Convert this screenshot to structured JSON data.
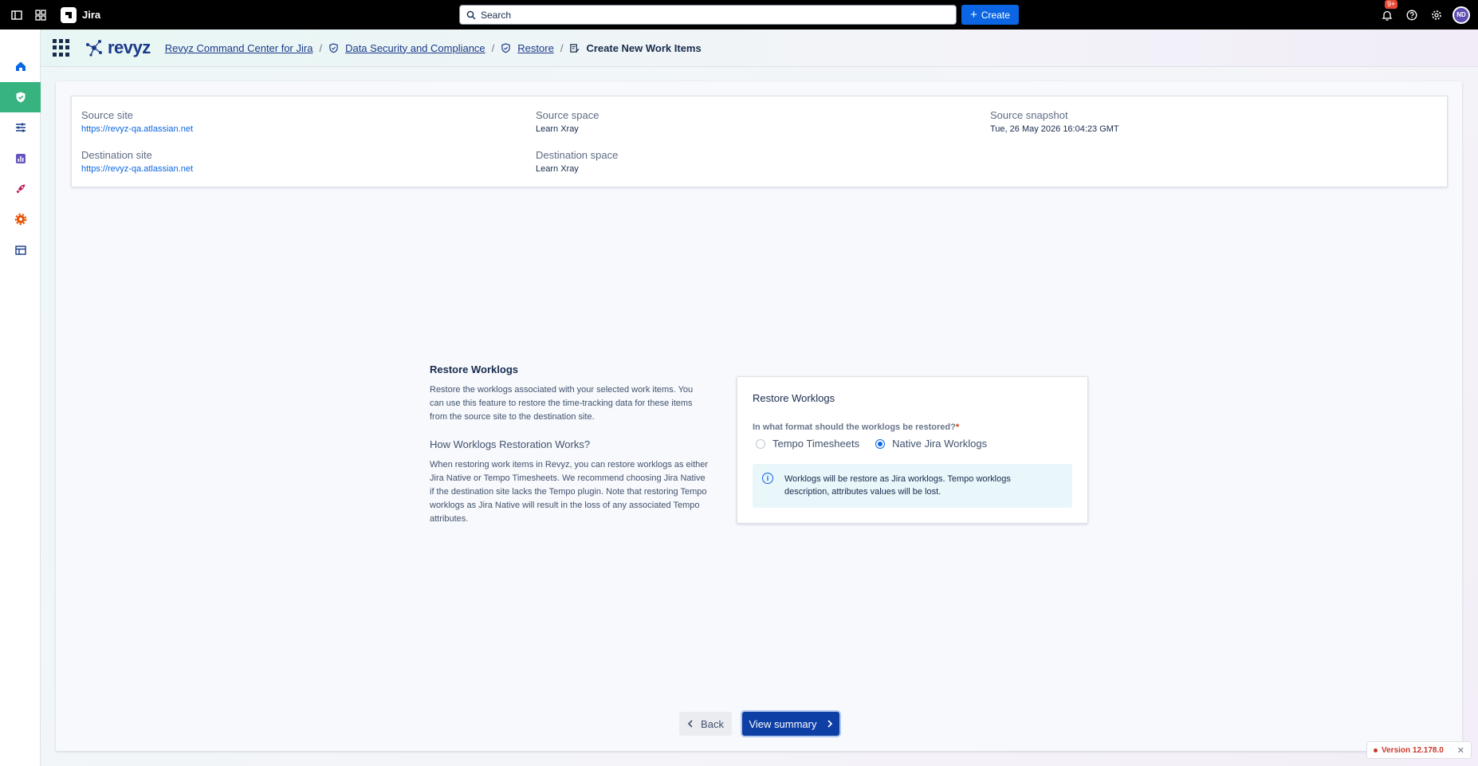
{
  "topbar": {
    "app_name": "Jira",
    "search_placeholder": "Search",
    "create_label": "Create",
    "notification_count": "9+",
    "avatar_initials": "ND"
  },
  "appbar": {
    "logo_text": "revyz",
    "breadcrumb": {
      "item1": "Revyz Command Center for Jira",
      "item2": "Data Security and Compliance",
      "item3": "Restore",
      "current": "Create New Work Items"
    }
  },
  "source_info": {
    "source_site_label": "Source site",
    "source_site_value": "https://revyz-qa.atlassian.net",
    "source_space_label": "Source space",
    "source_space_value": "Learn Xray",
    "source_snapshot_label": "Source snapshot",
    "source_snapshot_value": "Tue, 26 May 2026 16:04:23 GMT",
    "dest_site_label": "Destination site",
    "dest_site_value": "https://revyz-qa.atlassian.net",
    "dest_space_label": "Destination space",
    "dest_space_value": "Learn Xray"
  },
  "description": {
    "title": "Restore Worklogs",
    "body": "Restore the worklogs associated with your selected work items. You can use this feature to restore the time-tracking data for these items from the source site to the destination site.",
    "how_title": "How Worklogs Restoration Works?",
    "how_body": "When restoring work items in Revyz, you can restore worklogs as either Jira Native or Tempo Timesheets. We recommend choosing Jira Native if the destination site lacks the Tempo plugin. Note that restoring Tempo worklogs as Jira Native will result in the loss of any associated Tempo attributes."
  },
  "restore_card": {
    "title": "Restore Worklogs",
    "question": "In what format should the worklogs be restored?",
    "required_mark": "*",
    "option1": "Tempo Timesheets",
    "option2": "Native Jira Worklogs",
    "selected": "Native Jira Worklogs",
    "note": "Worklogs will be restore as Jira worklogs. Tempo worklogs description, attributes values will be lost."
  },
  "actions": {
    "back_label": "Back",
    "summary_label": "View summary"
  },
  "version": {
    "label": "Version 12.178.0"
  },
  "colors": {
    "primary": "#0d3fa5",
    "active_rail": "#36b37e",
    "link": "#0c66e4",
    "error": "#c9372c"
  }
}
